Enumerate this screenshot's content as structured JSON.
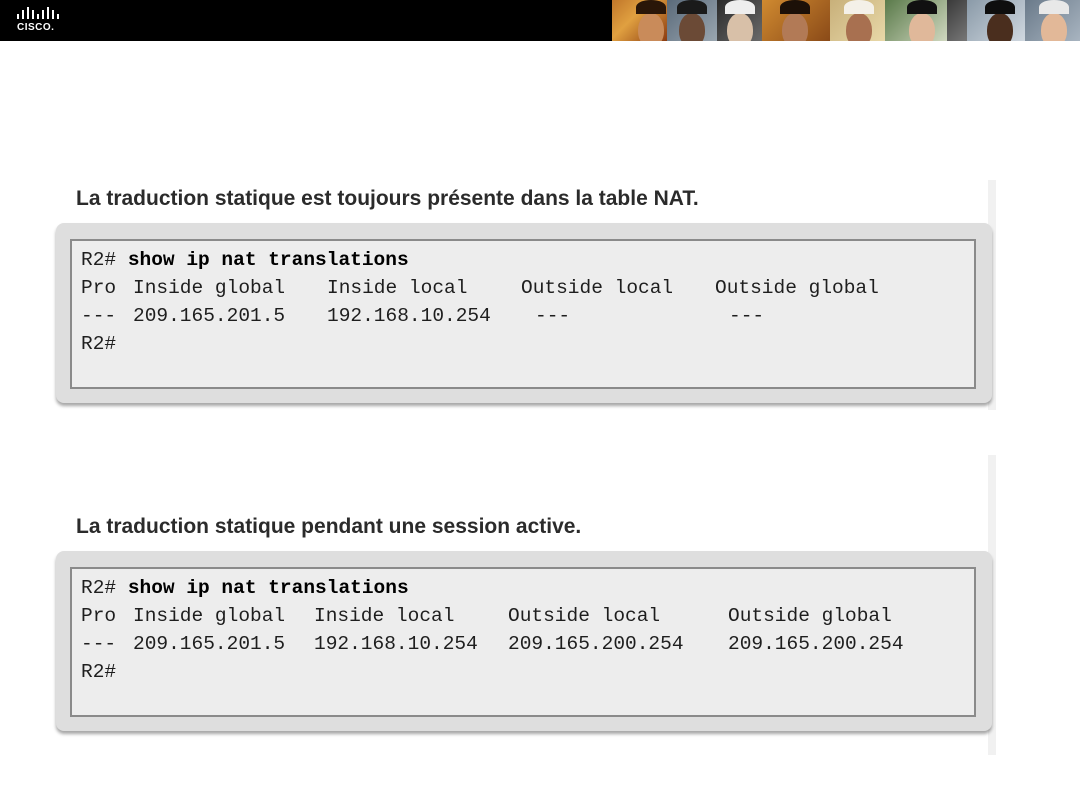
{
  "header": {
    "logo_text": "CISCO."
  },
  "sections": [
    {
      "title": "La traduction statique est toujours présente dans la table NAT.",
      "prompt": "R2#",
      "command": "show ip nat translations",
      "headers": [
        "Pro",
        "Inside global",
        "Inside local",
        "Outside local",
        "Outside global"
      ],
      "row": [
        "---",
        "209.165.201.5",
        "192.168.10.254",
        "---",
        "---"
      ],
      "end_prompt": "R2#"
    },
    {
      "title": "La traduction statique pendant une session active.",
      "prompt": "R2#",
      "command": "show ip nat translations",
      "headers": [
        "Pro",
        "Inside global",
        "Inside local",
        "Outside local",
        "Outside global"
      ],
      "row": [
        "---",
        "209.165.201.5",
        "192.168.10.254",
        "209.165.200.254",
        "209.165.200.254"
      ],
      "end_prompt": "R2#"
    }
  ]
}
